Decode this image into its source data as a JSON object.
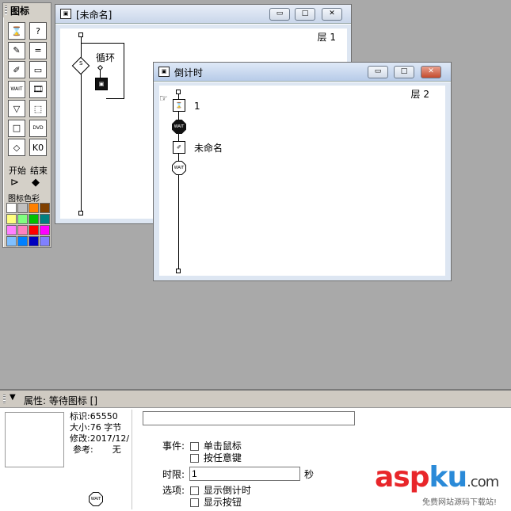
{
  "palette": {
    "title": "图标",
    "labels": {
      "start": "开始",
      "end": "结束",
      "colors": "图标色彩"
    },
    "buttons": [
      "⌛",
      "?",
      "✎",
      "=",
      "✐",
      "▭",
      "WAIT",
      "🎞",
      "▽",
      "⬚",
      "□",
      "DVD",
      "◇",
      "K0"
    ],
    "swatches": [
      "#ffffff",
      "#c0c0c0",
      "#ff8000",
      "#804000",
      "#ffff80",
      "#80ff80",
      "#00c000",
      "#008080",
      "#ff80ff",
      "#ff80c0",
      "#ff0000",
      "#ff00ff",
      "#80c0ff",
      "#0080ff",
      "#0000c0",
      "#8080ff"
    ]
  },
  "window1": {
    "title": "[未命名]",
    "layer": "层 1",
    "loop_label": "循环",
    "buttons": {
      "min": "▭",
      "max": "□",
      "close": "✕"
    }
  },
  "window2": {
    "title": "倒计时",
    "layer": "层 2",
    "items": [
      {
        "label": "1"
      },
      {
        "label": ""
      },
      {
        "label": "未命名"
      },
      {
        "label": ""
      }
    ],
    "buttons": {
      "min": "▭",
      "max": "□",
      "close": "✕"
    }
  },
  "properties": {
    "title": "属性: 等待图标 []",
    "info": {
      "id": "标识:65550",
      "size": "大小:76 字节",
      "modified": "修改:2017/12/",
      "ref_label": "参考:",
      "ref_value": "无"
    },
    "name_value": "",
    "events_label": "事件:",
    "event_click": "单击鼠标",
    "event_key": "按任意键",
    "timelimit_label": "时限:",
    "timelimit_value": "1",
    "timelimit_unit": "秒",
    "options_label": "选项:",
    "option_countdown": "显示倒计时",
    "option_button": "显示按钮"
  },
  "watermark": {
    "brand_a": "asp",
    "brand_b": "ku",
    "brand_c": ".com",
    "sub": "免费网站源码下载站!"
  },
  "colors": {
    "brand_red": "#e8262a",
    "brand_blue": "#2a8ad8"
  }
}
